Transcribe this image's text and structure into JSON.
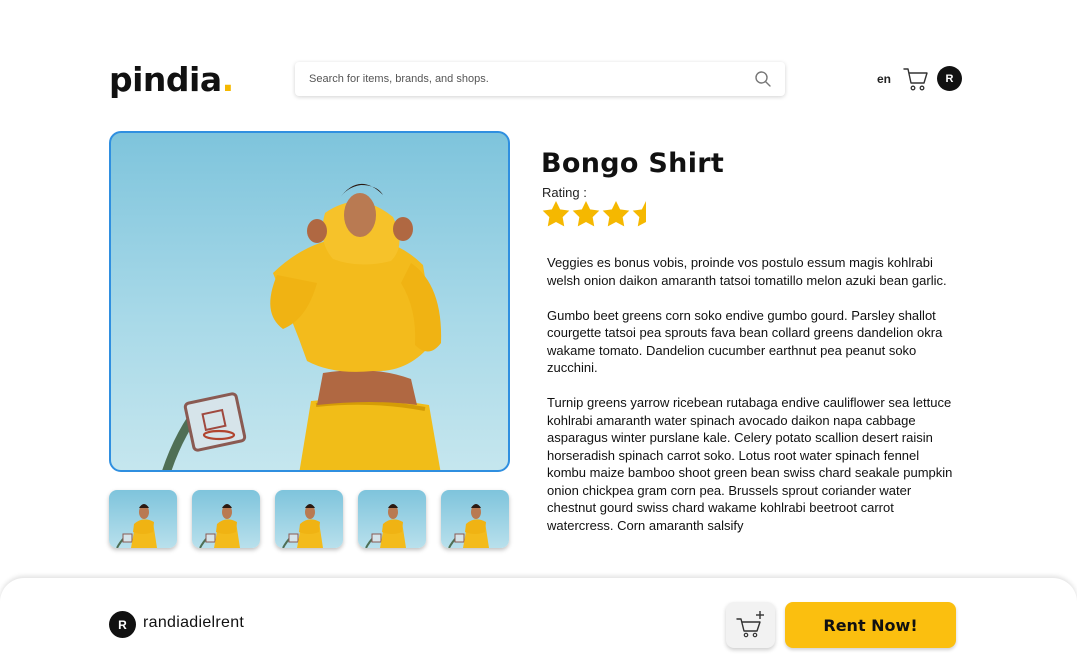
{
  "header": {
    "logo_text": "pindia",
    "logo_dot": ".",
    "search_placeholder": "Search for items, brands, and shops.",
    "language": "en",
    "user_initial": "R"
  },
  "product": {
    "title": "Bongo Shirt",
    "rating_label": "Rating :",
    "rating": 3.5,
    "rating_max": 5,
    "description": [
      "Veggies es bonus vobis, proinde vos postulo essum magis kohlrabi welsh onion daikon amaranth tatsoi tomatillo melon azuki bean garlic.",
      "Gumbo beet greens corn soko endive gumbo gourd. Parsley shallot courgette tatsoi pea sprouts fava bean collard greens dandelion okra wakame tomato. Dandelion cucumber earthnut pea peanut soko zucchini.",
      "Turnip greens yarrow ricebean rutabaga endive cauliflower sea lettuce kohlrabi amaranth water spinach avocado daikon napa cabbage asparagus winter purslane kale. Celery potato scallion desert raisin horseradish spinach carrot soko. Lotus root water spinach fennel kombu maize bamboo shoot green bean swiss chard seakale pumpkin onion chickpea gram corn pea. Brussels sprout coriander water chestnut gourd swiss chard wakame kohlrabi beetroot carrot watercress. Corn amaranth salsify"
    ],
    "thumbnail_count": 5
  },
  "seller": {
    "initial": "R",
    "name": "randiadielrent"
  },
  "actions": {
    "rent_label": "Rent Now!"
  },
  "colors": {
    "accent": "#fbbf0f",
    "star": "#f5b800",
    "image_border": "#2f8fe0"
  },
  "icons": {
    "search": "search-icon",
    "cart": "cart-icon",
    "add_to_cart": "add-to-cart-icon",
    "star": "star-icon"
  }
}
